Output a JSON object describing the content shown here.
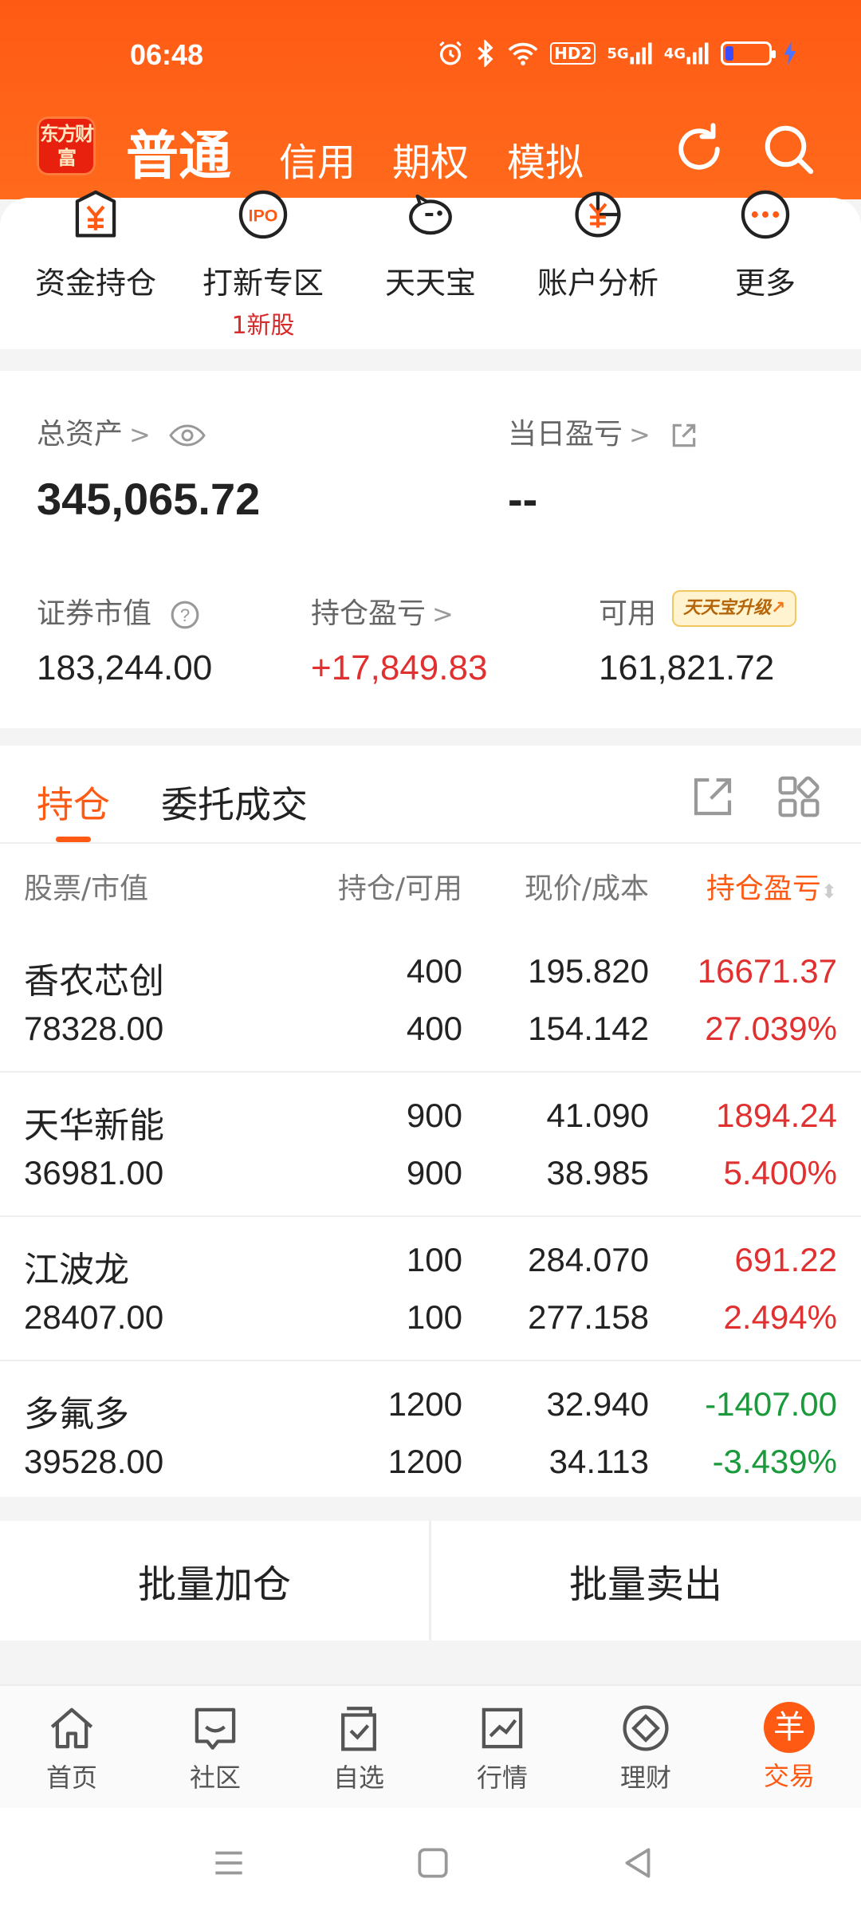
{
  "status_bar": {
    "time": "06:48",
    "network_1": "5G",
    "network_2": "4G",
    "hd_label": "HD2",
    "icons": [
      "alarm-icon",
      "bluetooth-icon",
      "wifi-icon",
      "signal-icon",
      "battery-icon",
      "charging-icon"
    ]
  },
  "header": {
    "logo_text": "东方财富",
    "tabs": [
      {
        "label": "普通",
        "active": true
      },
      {
        "label": "信用",
        "active": false
      },
      {
        "label": "期权",
        "active": false
      },
      {
        "label": "模拟",
        "active": false
      }
    ],
    "icons": [
      "refresh-icon",
      "search-icon"
    ]
  },
  "quick_menu": {
    "items": [
      {
        "label": "资金持仓",
        "icon": "fund-icon"
      },
      {
        "label": "打新专区",
        "icon": "ipo-icon",
        "badge": "1新股",
        "icon_text": "IPO"
      },
      {
        "label": "天天宝",
        "icon": "piggy-bank-icon"
      },
      {
        "label": "账户分析",
        "icon": "analysis-icon"
      },
      {
        "label": "更多",
        "icon": "more-icon"
      }
    ]
  },
  "assets": {
    "total_label": "总资产",
    "total_value": "345,065.72",
    "daily_pl_label": "当日盈亏",
    "daily_pl_value": "--",
    "market_value_label": "证券市值",
    "market_value": "183,244.00",
    "position_pl_label": "持仓盈亏",
    "position_pl_value": "+17,849.83",
    "available_label": "可用",
    "available_value": "161,821.72",
    "upgrade_badge": "天天宝升级"
  },
  "holdings": {
    "tabs": [
      {
        "label": "持仓",
        "active": true
      },
      {
        "label": "委托成交",
        "active": false
      }
    ],
    "columns": [
      "股票/市值",
      "持仓/可用",
      "现价/成本",
      "持仓盈亏"
    ],
    "rows": [
      {
        "name": "香农芯创",
        "market_value": "78328.00",
        "position": "400",
        "available": "400",
        "price": "195.820",
        "cost": "154.142",
        "pl": "16671.37",
        "pl_pct": "27.039%",
        "direction": "up"
      },
      {
        "name": "天华新能",
        "market_value": "36981.00",
        "position": "900",
        "available": "900",
        "price": "41.090",
        "cost": "38.985",
        "pl": "1894.24",
        "pl_pct": "5.400%",
        "direction": "up"
      },
      {
        "name": "江波龙",
        "market_value": "28407.00",
        "position": "100",
        "available": "100",
        "price": "284.070",
        "cost": "277.158",
        "pl": "691.22",
        "pl_pct": "2.494%",
        "direction": "up"
      },
      {
        "name": "多氟多",
        "market_value": "39528.00",
        "position": "1200",
        "available": "1200",
        "price": "32.940",
        "cost": "34.113",
        "pl": "-1407.00",
        "pl_pct": "-3.439%",
        "direction": "down"
      }
    ]
  },
  "batch": {
    "add_label": "批量加仓",
    "sell_label": "批量卖出"
  },
  "bottom_nav": {
    "items": [
      {
        "label": "首页",
        "icon": "home-icon"
      },
      {
        "label": "社区",
        "icon": "community-icon"
      },
      {
        "label": "自选",
        "icon": "watchlist-icon"
      },
      {
        "label": "行情",
        "icon": "market-icon"
      },
      {
        "label": "理财",
        "icon": "wealth-icon"
      },
      {
        "label": "交易",
        "icon": "trade-icon",
        "active": true,
        "icon_text": "羊"
      }
    ]
  },
  "colors": {
    "brand": "#ff5a14",
    "up": "#e03030",
    "down": "#1a9a3a"
  }
}
